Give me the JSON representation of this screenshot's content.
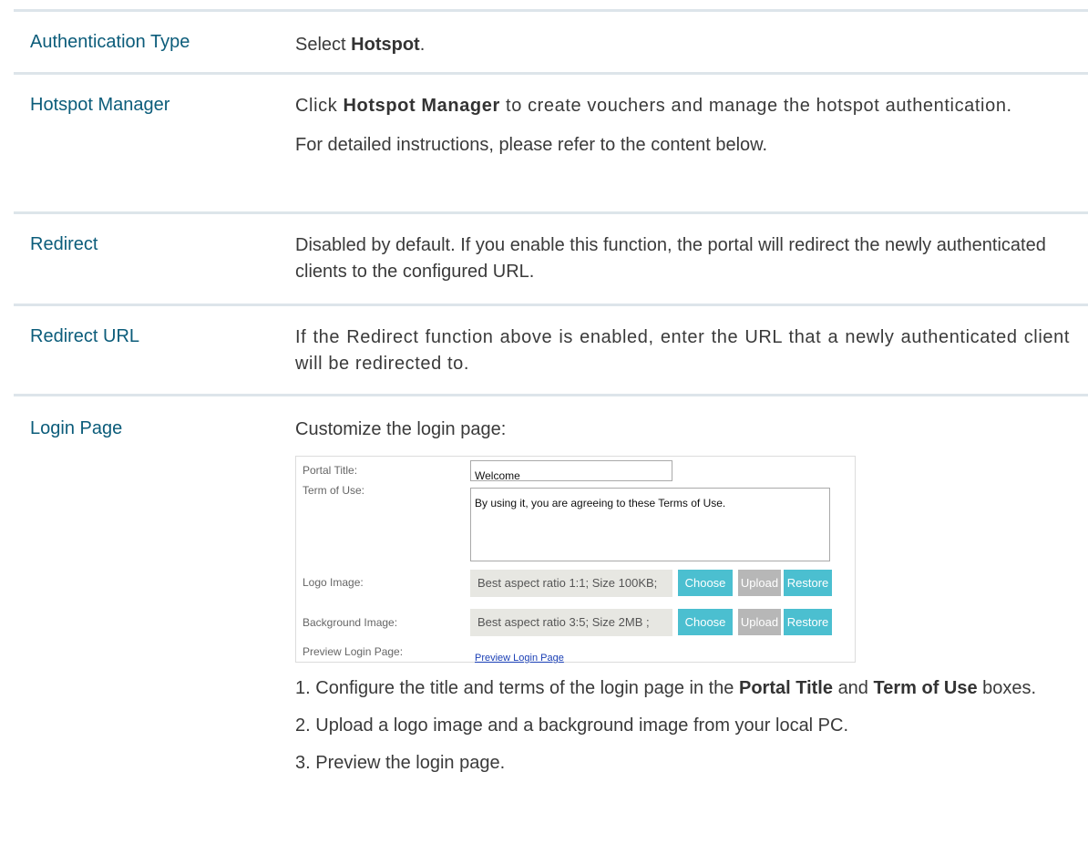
{
  "rows": {
    "auth_type": {
      "label": "Authentication Type",
      "select_prefix": "Select",
      "select_value": "Hotspot",
      "select_suffix": "."
    },
    "hotspot_manager": {
      "label": "Hotspot Manager",
      "line1_prefix": "Click",
      "line1_kw": "Hotspot Manager",
      "line1_suffix": "to create vouchers and manage the hotspot authentication.",
      "line2": "For detailed instructions, please refer to the content below."
    },
    "redirect": {
      "label": "Redirect",
      "text": "Disabled by default. If you enable this function, the portal will redirect the newly authenticated clients to the configured URL."
    },
    "redirect_url": {
      "label": "Redirect URL",
      "text": "If the Redirect function above is enabled, enter the URL that a newly authenticated client will be redirected to."
    },
    "login_page": {
      "label": "Login Page",
      "intro": "Customize the login page:",
      "form": {
        "portal_title_label": "Portal Title:",
        "portal_title_value": "Welcome",
        "term_label": "Term of Use:",
        "term_value": "By using it, you are agreeing to these Terms of Use.",
        "logo_label": "Logo Image:",
        "logo_hint": "Best aspect ratio 1:1; Size 100KB;",
        "bg_label": "Background Image:",
        "bg_hint": "Best aspect ratio 3:5; Size 2MB ;",
        "choose": "Choose",
        "upload": "Upload",
        "restore": "Restore",
        "preview_label": "Preview Login Page:",
        "preview_link": "Preview Login Page"
      },
      "steps": {
        "s1_num": "1.",
        "s1_a": "Configure the title and terms of the login page in the",
        "s1_kw1": "Portal Title",
        "s1_and": "and",
        "s1_kw2": "Term of Use",
        "s1_b": "boxes.",
        "s2_num": "2.",
        "s2": "Upload a logo image and a background image from your local PC.",
        "s3_num": "3.",
        "s3": "Preview the login page."
      }
    }
  }
}
